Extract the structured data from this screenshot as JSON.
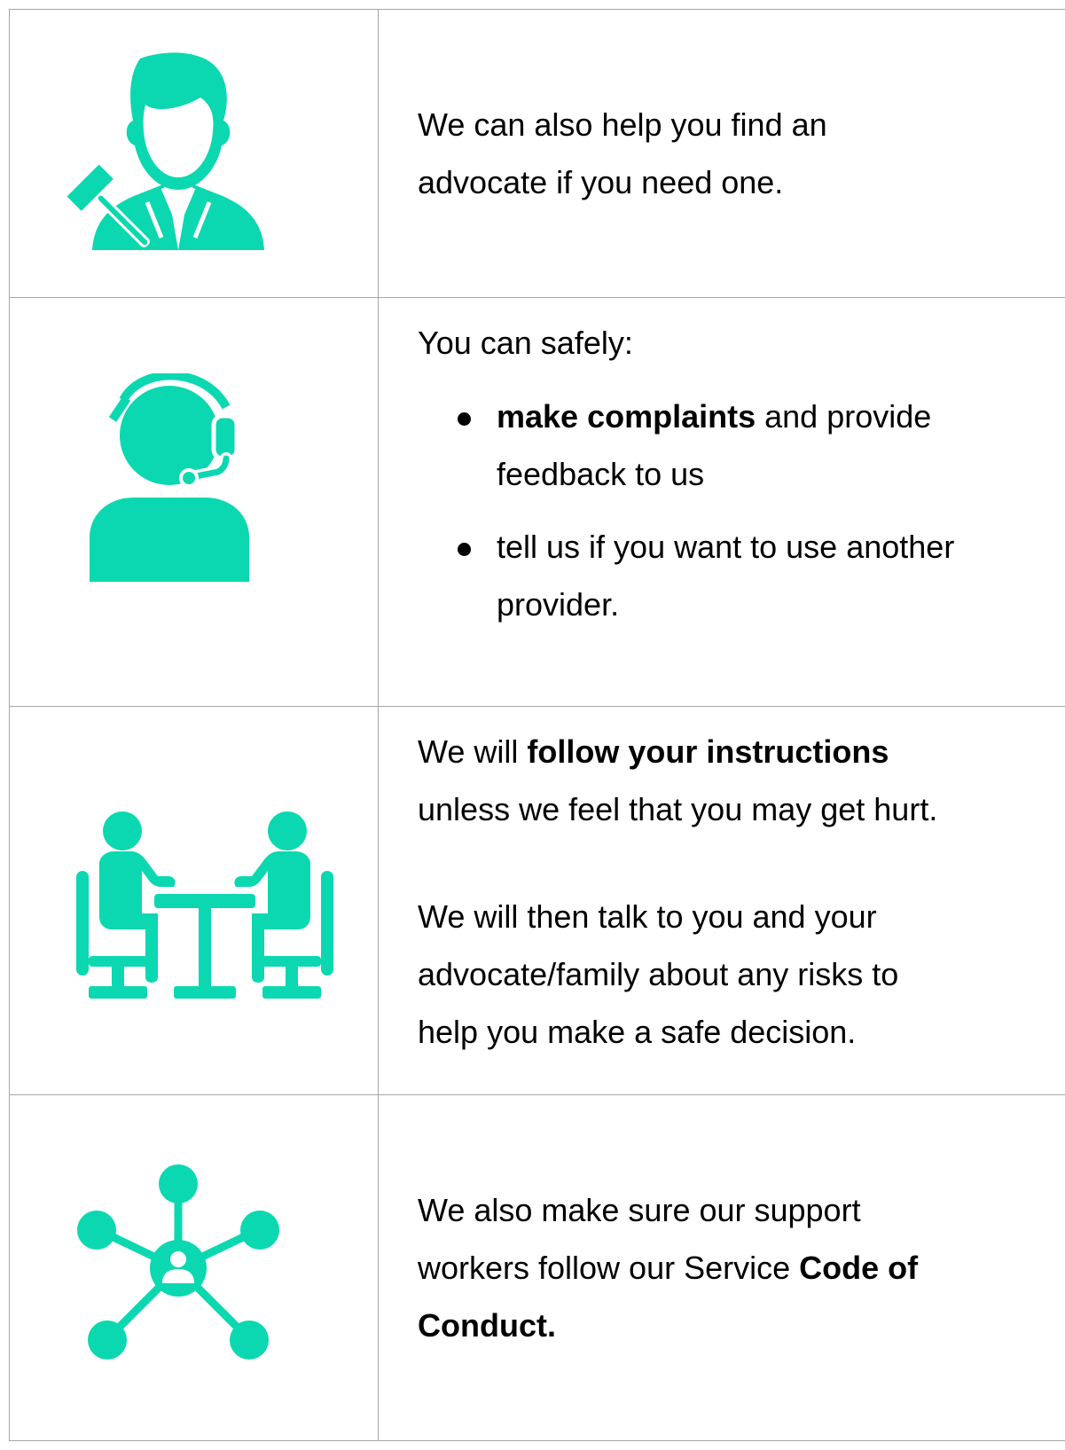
{
  "colors": {
    "icon_accent": "#0bd8b0",
    "border": "#a6a6a6"
  },
  "rows": [
    {
      "icon": "lawyer-with-gavel-icon",
      "line1": " We can also help you find an",
      "line2": "advocate if you need one."
    },
    {
      "icon": "headset-support-person-icon",
      "intro": "You can safely:",
      "bullet1_bold": "make complaints",
      "bullet1_rest": " and provide",
      "bullet1_line2": "feedback to us",
      "bullet2_line1": "tell us if you want to use another",
      "bullet2_line2": "provider."
    },
    {
      "icon": "meeting-at-table-icon",
      "p1_pre": "We will ",
      "p1_bold": "follow your instructions",
      "p1_line2": "unless we feel that you may get hurt.",
      "p2_line1": "We will then talk to you and your",
      "p2_line2": "advocate/family about any risks to",
      "p2_line3": "help you make a safe decision."
    },
    {
      "icon": "network-hub-person-icon",
      "line1": "We also make sure our support",
      "line2_pre": "workers follow our Service ",
      "line2_bold": "Code of",
      "line3_bold": "Conduct."
    }
  ]
}
